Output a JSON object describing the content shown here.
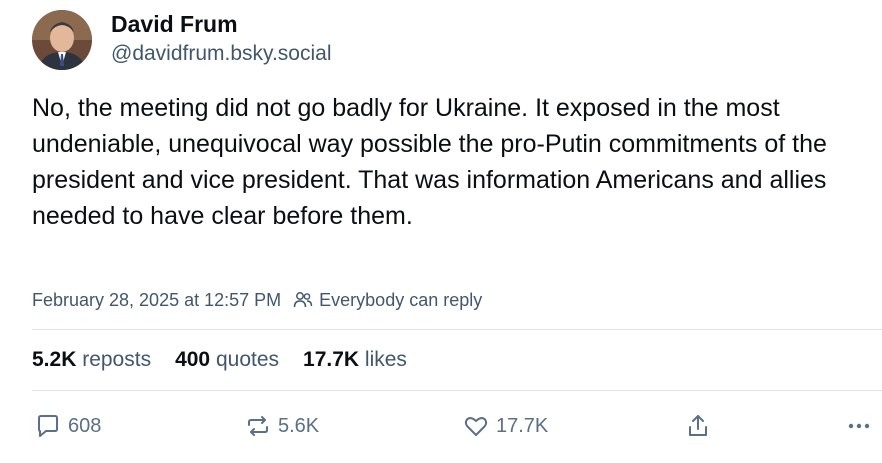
{
  "author": {
    "name": "David Frum",
    "handle": "@davidfrum.bsky.social",
    "avatar_icon": "profile-photo"
  },
  "post": {
    "text": "No, the meeting did not go badly for Ukraine. It exposed in the most undeniable, unequivocal way possible the pro-Putin commitments of the president and vice president. That was information Americans and allies needed to have clear before them.",
    "timestamp": "February 28, 2025 at 12:57 PM",
    "reply_setting": "Everybody can reply"
  },
  "stats": {
    "reposts_count": "5.2K",
    "reposts_label": "reposts",
    "quotes_count": "400",
    "quotes_label": "quotes",
    "likes_count": "17.7K",
    "likes_label": "likes"
  },
  "actions": {
    "reply_count": "608",
    "repost_count": "5.6K",
    "like_count": "17.7K",
    "icons": [
      "reply-icon",
      "repost-icon",
      "like-icon",
      "share-icon",
      "more-icon"
    ]
  },
  "colors": {
    "text_primary": "#0b0f14",
    "text_secondary": "#42576c",
    "icon": "#5b6f86",
    "divider": "#dfe4ea"
  }
}
